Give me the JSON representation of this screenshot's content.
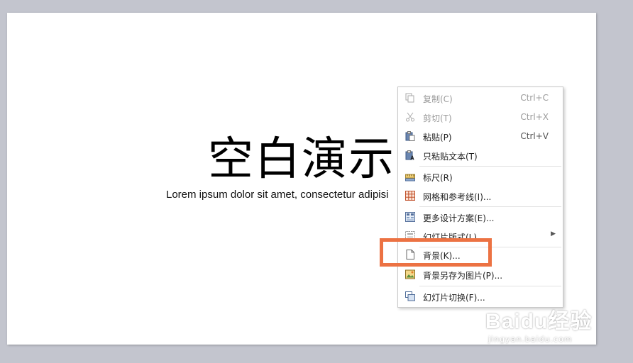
{
  "slide": {
    "title": "空白演示",
    "subtitle": "Lorem ipsum dolor sit amet, consectetur adipisi"
  },
  "context_menu": {
    "items": [
      {
        "label": "复制(C)",
        "shortcut": "Ctrl+C",
        "icon": "copy-icon",
        "disabled": true
      },
      {
        "label": "剪切(T)",
        "shortcut": "Ctrl+X",
        "icon": "cut-icon",
        "disabled": true
      },
      {
        "label": "粘贴(P)",
        "shortcut": "Ctrl+V",
        "icon": "paste-icon",
        "disabled": false
      },
      {
        "label": "只粘贴文本(T)",
        "shortcut": "",
        "icon": "paste-text-icon",
        "disabled": false
      },
      {
        "label": "标尺(R)",
        "shortcut": "",
        "icon": "ruler-icon",
        "disabled": false
      },
      {
        "label": "网格和参考线(I)...",
        "shortcut": "",
        "icon": "grid-icon",
        "disabled": false
      },
      {
        "label": "更多设计方案(E)...",
        "shortcut": "",
        "icon": "design-icon",
        "disabled": false
      },
      {
        "label": "幻灯片版式(L)",
        "shortcut": "",
        "icon": "layout-icon",
        "disabled": false,
        "submenu": true
      },
      {
        "label": "背景(K)...",
        "shortcut": "",
        "icon": "background-icon",
        "disabled": false,
        "highlighted": true
      },
      {
        "label": "背景另存为图片(P)...",
        "shortcut": "",
        "icon": "save-bg-image-icon",
        "disabled": false
      },
      {
        "label": "幻灯片切换(F)...",
        "shortcut": "",
        "icon": "slide-transition-icon",
        "disabled": false
      }
    ]
  },
  "colors": {
    "highlight_border": "#ec7243",
    "workspace_bg": "#c3c5ce"
  },
  "watermark": {
    "logo": "Baidu经验",
    "url": "jingyan.baidu.com"
  }
}
